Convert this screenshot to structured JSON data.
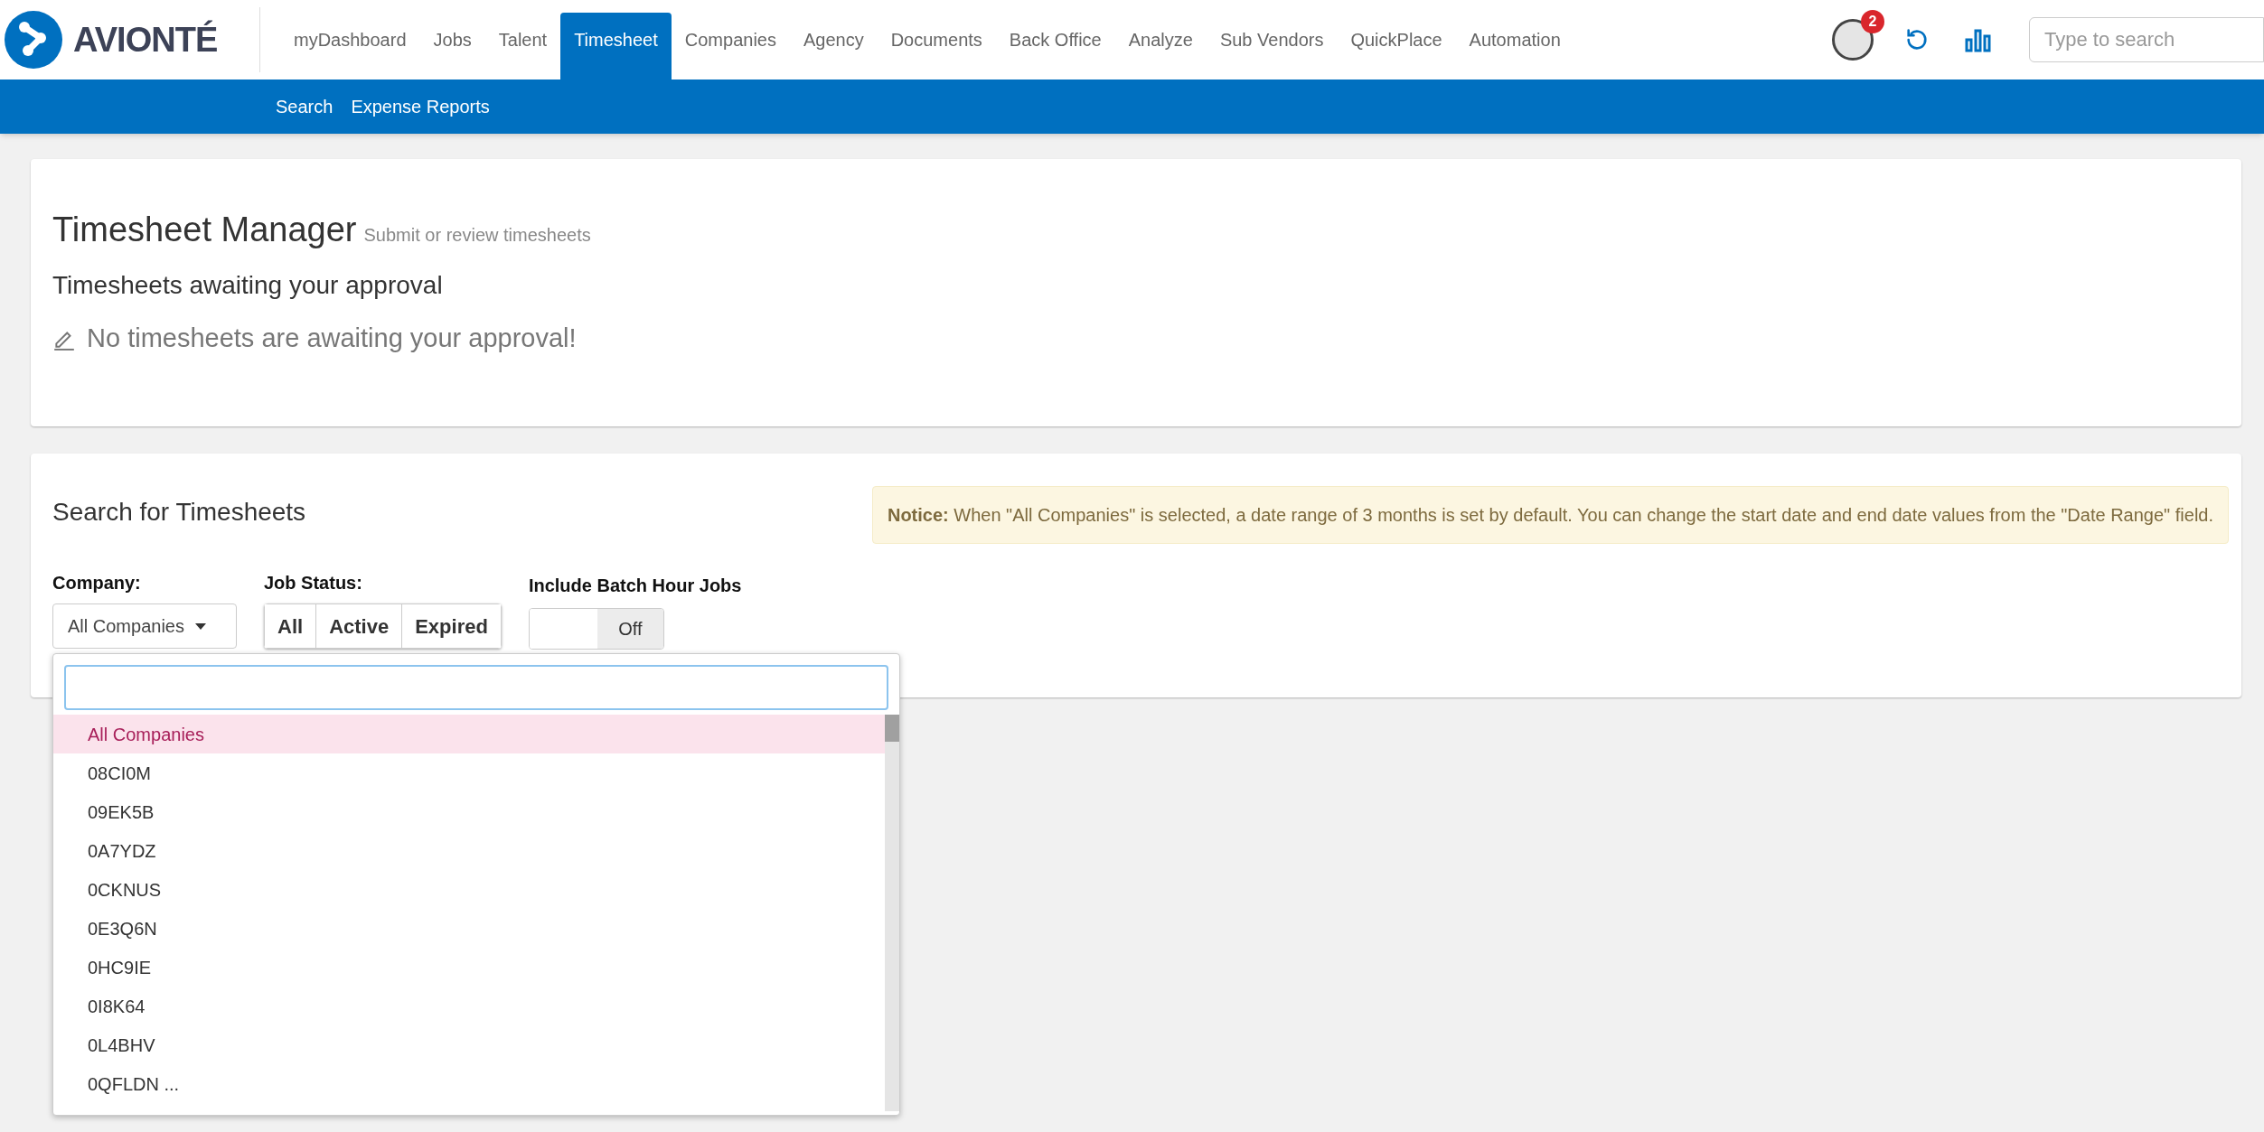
{
  "brand": {
    "name": "AVIONTÉ"
  },
  "nav": [
    {
      "label": "myDashboard",
      "selected": false
    },
    {
      "label": "Jobs",
      "selected": false
    },
    {
      "label": "Talent",
      "selected": false
    },
    {
      "label": "Timesheet",
      "selected": true
    },
    {
      "label": "Companies",
      "selected": false
    },
    {
      "label": "Agency",
      "selected": false
    },
    {
      "label": "Documents",
      "selected": false
    },
    {
      "label": "Back Office",
      "selected": false
    },
    {
      "label": "Analyze",
      "selected": false
    },
    {
      "label": "Sub Vendors",
      "selected": false
    },
    {
      "label": "QuickPlace",
      "selected": false
    },
    {
      "label": "Automation",
      "selected": false
    }
  ],
  "notifications": {
    "count": "2"
  },
  "search": {
    "placeholder": "Type to search"
  },
  "subnav": [
    "Search",
    "Expense Reports"
  ],
  "manager": {
    "title": "Timesheet Manager",
    "subtitle": "Submit or review timesheets",
    "heading": "Timesheets awaiting your approval",
    "message": "No timesheets are awaiting your approval!"
  },
  "search_panel": {
    "title": "Search for Timesheets",
    "notice_label": "Notice:",
    "notice": "When \"All Companies\" is selected, a date range of 3 months is set by default. You can change the start date and end date values from the \"Date Range\" field.",
    "company_label": "Company:",
    "company_value": "All Companies",
    "job_status_label": "Job Status:",
    "job_status": [
      {
        "label": "All",
        "selected": false
      },
      {
        "label": "Active",
        "selected": false
      },
      {
        "label": "Expired",
        "selected": false
      }
    ],
    "batch_label": "Include Batch Hour Jobs",
    "batch_toggle": {
      "on": false,
      "label": "Off"
    }
  },
  "company_dropdown": {
    "items": [
      {
        "label": "All Companies",
        "selected": true
      },
      {
        "label": "08CI0M",
        "selected": false
      },
      {
        "label": "09EK5B",
        "selected": false
      },
      {
        "label": "0A7YDZ",
        "selected": false
      },
      {
        "label": "0CKNUS",
        "selected": false
      },
      {
        "label": "0E3Q6N",
        "selected": false
      },
      {
        "label": "0HC9IE",
        "selected": false
      },
      {
        "label": "0I8K64",
        "selected": false
      },
      {
        "label": "0L4BHV",
        "selected": false
      },
      {
        "label": "0QFLDN ...",
        "selected": false
      }
    ]
  }
}
